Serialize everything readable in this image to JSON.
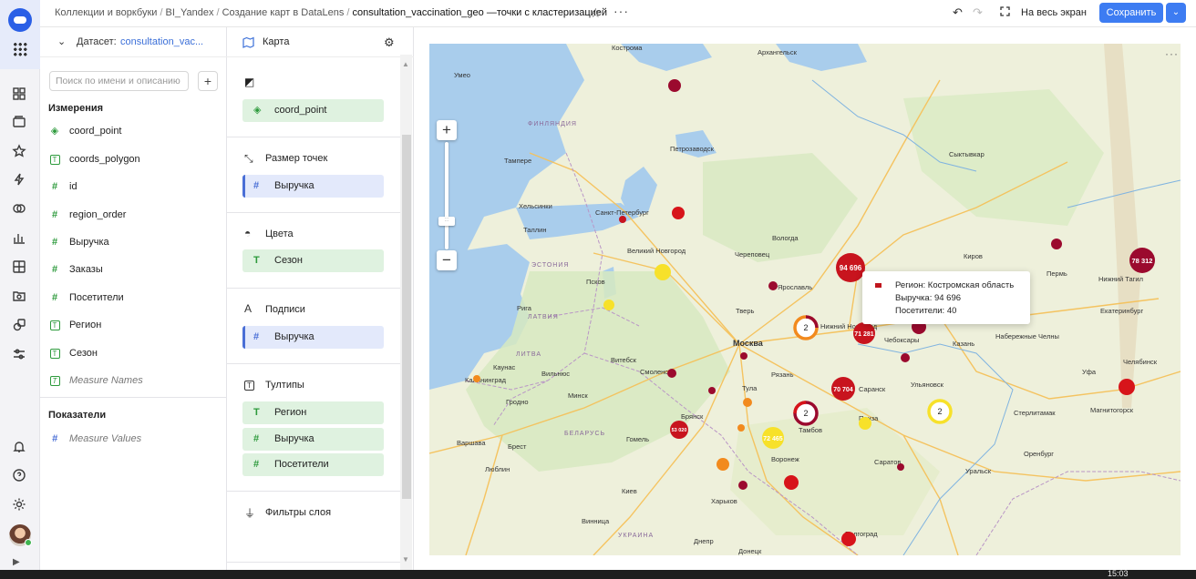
{
  "header": {
    "breadcrumbs": [
      "Коллекции и воркбуки",
      "BI_Yandex",
      "Создание карт в DataLens"
    ],
    "current": "consultation_vaccination_geo —точки с кластеризацией",
    "fullscreen_label": "На весь экран",
    "save_label": "Сохранить"
  },
  "dataset": {
    "label": "Датасет:",
    "name": "consultation_vac...",
    "search_placeholder": "Поиск по имени и описанию",
    "dimensions_title": "Измерения",
    "dimensions": [
      {
        "name": "coord_point",
        "type": "geo"
      },
      {
        "name": "coords_polygon",
        "type": "text"
      },
      {
        "name": "id",
        "type": "number"
      },
      {
        "name": "region_order",
        "type": "number"
      },
      {
        "name": "Выручка",
        "type": "number"
      },
      {
        "name": "Заказы",
        "type": "number"
      },
      {
        "name": "Посетители",
        "type": "number"
      },
      {
        "name": "Регион",
        "type": "text"
      },
      {
        "name": "Сезон",
        "type": "text"
      },
      {
        "name": "Measure Names",
        "type": "text"
      }
    ],
    "measures_title": "Показатели",
    "measures": [
      {
        "name": "Measure Values"
      }
    ]
  },
  "sections": {
    "title": "Карта",
    "layer_type": "Точки с клас...",
    "geo_field": "coord_point",
    "size": {
      "title": "Размер точек",
      "field": "Выручка"
    },
    "colors": {
      "title": "Цвета",
      "field": "Сезон"
    },
    "labels": {
      "title": "Подписи",
      "field": "Выручка"
    },
    "tooltips": {
      "title": "Тултипы",
      "fields": [
        "Регион",
        "Выручка",
        "Посетители"
      ]
    },
    "filters": {
      "title": "Фильтры слоя"
    }
  },
  "map": {
    "cities": [
      "Кострома",
      "Архангельск",
      "Умео",
      "Петрозаводск",
      "Тампере",
      "Хельсинки",
      "Санкт-Петербург",
      "Таллин",
      "Вологда",
      "Сыктывкар",
      "Великий Новгород",
      "Череповец",
      "Псков",
      "Ярославль",
      "Киров",
      "Пермь",
      "Нижний Тагил",
      "Рига",
      "Тверь",
      "Нижний Новгород",
      "Казань",
      "Набережные Челны",
      "Екатеринбург",
      "Чебоксары",
      "Москва",
      "Вильнюс",
      "Смоленск",
      "Каунас",
      "Калининград",
      "Витебск",
      "Рязань",
      "Гродно",
      "Минск",
      "Тула",
      "Саранск",
      "Ульяновск",
      "Уфа",
      "Челябинск",
      "Брянск",
      "Пенза",
      "Стерлитамак",
      "Магнитогорск",
      "Варшава",
      "Брест",
      "Гомель",
      "Воронеж",
      "Тамбов",
      "Саратов",
      "Оренбург",
      "Уральск",
      "Люблин",
      "Киев",
      "Харьков",
      "Волгоград",
      "Винница",
      "Днепр",
      "Донецк"
    ],
    "country_labels": [
      "ФИНЛЯНДИЯ",
      "ЭСТОНИЯ",
      "ЛАТВИЯ",
      "ЛИТВА",
      "БЕЛАРУСЬ",
      "УКРАИНА"
    ],
    "point_labels": [
      "94 696",
      "78 312",
      "71 281",
      "70 704",
      "53 020",
      "72 465"
    ],
    "cluster_labels": [
      "2",
      "2",
      "2"
    ],
    "tooltip": {
      "region": "Регион: Костромская область",
      "revenue": "Выручка: 94 696",
      "visitors": "Посетители: 40"
    }
  },
  "taskbar": {
    "clock": "15:03"
  },
  "colors": {
    "accent": "#3d7cf2",
    "winter": "#9b0a2e",
    "autumn": "#f28a1e",
    "summer": "#f7e12a",
    "spring": "#e02a18"
  }
}
